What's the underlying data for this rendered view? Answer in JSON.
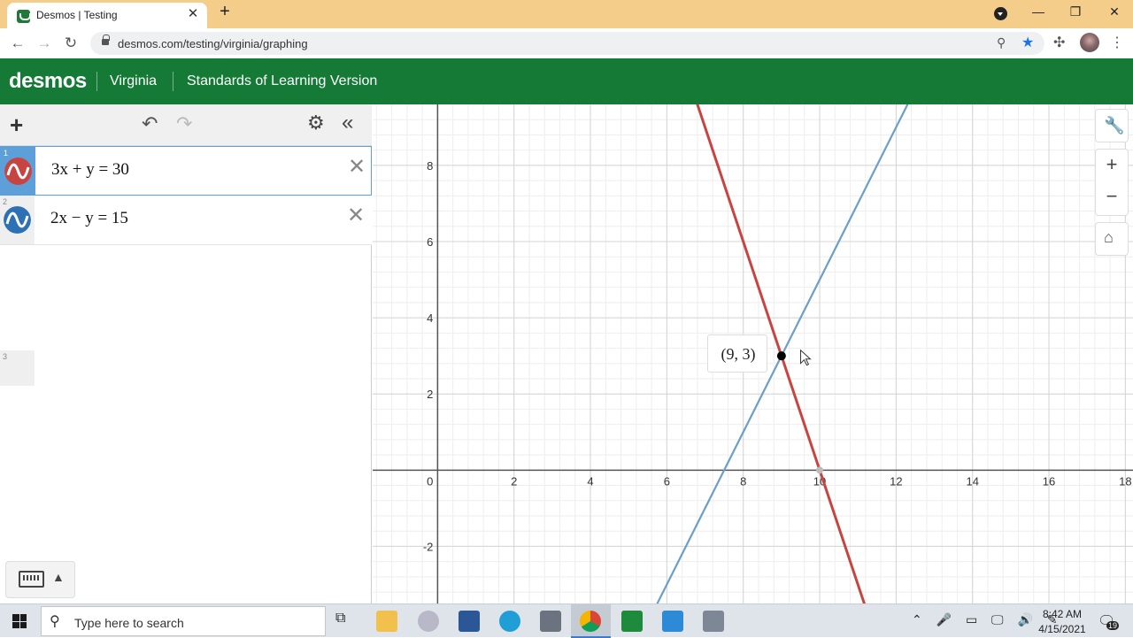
{
  "browser": {
    "tab_title": "Desmos | Testing",
    "tab_close": "✕",
    "new_tab": "+",
    "url": "desmos.com/testing/virginia/graphing",
    "window_controls": {
      "minimize": "—",
      "maximize": "❐",
      "close": "✕"
    }
  },
  "header": {
    "logo": "desmos",
    "state": "Virginia",
    "version": "Standards of Learning Version",
    "background": "#147a36"
  },
  "expressions": [
    {
      "index": "1",
      "latex": "3x + y = 30",
      "color": "#c74440",
      "active": true
    },
    {
      "index": "2",
      "latex": "2x − y = 15",
      "color": "#2d70b3",
      "active": false
    },
    {
      "index": "3",
      "latex": "",
      "color": "",
      "active": false
    }
  ],
  "graph": {
    "x_ticks": [
      "2",
      "4",
      "6",
      "8",
      "10",
      "12",
      "14",
      "16",
      "18"
    ],
    "y_ticks": [
      "8",
      "6",
      "4",
      "2",
      "-2"
    ],
    "origin_label": "0",
    "intersection_label": "(9, 3)",
    "line_colors": {
      "line1": "#c74440",
      "line2": "#6b9fc8"
    }
  },
  "chart_data": {
    "type": "line",
    "title": "",
    "xlabel": "",
    "ylabel": "",
    "xlim": [
      -1.7,
      18.2
    ],
    "ylim": [
      -3.5,
      9.6
    ],
    "series": [
      {
        "name": "3x + y = 30",
        "x": [
          5.8,
          11.3
        ],
        "y": [
          12.6,
          -3.9
        ],
        "color": "#c74440"
      },
      {
        "name": "2x − y = 15",
        "x": [
          4.9,
          12.3
        ],
        "y": [
          -5.2,
          9.6
        ],
        "color": "#6b9fc8"
      }
    ],
    "points": [
      {
        "x": 9,
        "y": 3,
        "label": "(9, 3)"
      }
    ],
    "grid": true
  },
  "taskbar": {
    "search_placeholder": "Type here to search",
    "time": "8:42 AM",
    "date": "4/15/2021",
    "notification_count": "19"
  }
}
